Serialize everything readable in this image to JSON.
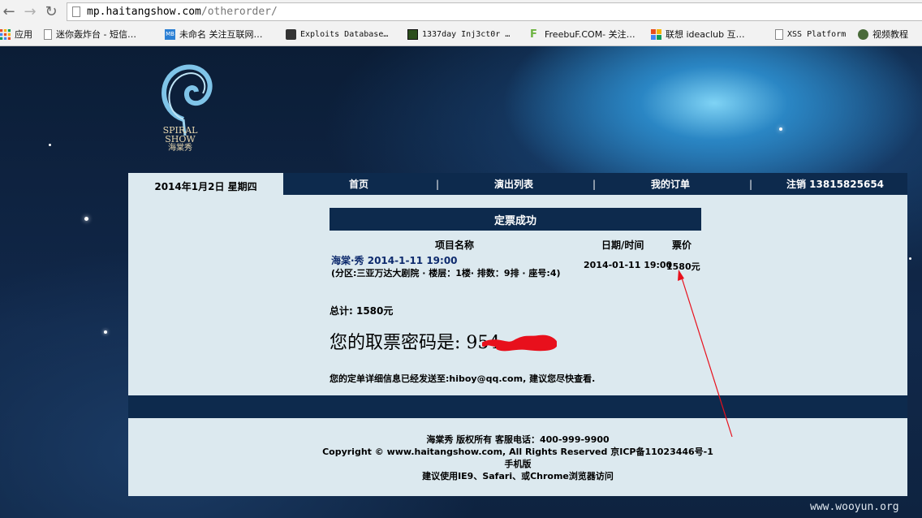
{
  "browser": {
    "url_host": "mp.haitangshow.com",
    "url_path": "/otherorder/",
    "bookmarks": [
      {
        "label": "应用",
        "icon": "apps-grid-icon",
        "color": "#e34c26"
      },
      {
        "label": "迷你轰炸台 - 短信…",
        "icon": "page-icon",
        "color": "#ffffff"
      },
      {
        "label": "未命名 关注互联网…",
        "icon": "mb-icon",
        "color": "#2a7fd4"
      },
      {
        "label": "Exploits Database…",
        "icon": "exploit-db-icon",
        "color": "#333333"
      },
      {
        "label": "1337day Inj3ct0r …",
        "icon": "1337day-icon",
        "color": "#2c4d1c"
      },
      {
        "label": "FreebuF.COM- 关注…",
        "icon": "freebuf-icon",
        "color": "#6cb33f"
      },
      {
        "label": "联想 ideaclub 互…",
        "icon": "lenovo-icon",
        "color": "#e94e1b"
      },
      {
        "label": "XSS Platform",
        "icon": "page-icon",
        "color": "#ffffff"
      },
      {
        "label": "视频教程",
        "icon": "avatar-icon",
        "color": "#4a6b3a"
      }
    ]
  },
  "site": {
    "logo_line1": "SPIRAL",
    "logo_line2": "SHOW",
    "logo_line3": "海棠秀"
  },
  "nav": {
    "date": "2014年1月2日 星期四",
    "home": "首页",
    "shows": "演出列表",
    "orders": "我的订单",
    "logout": "注销 13815825654",
    "separator": "|"
  },
  "order": {
    "title": "定票成功",
    "col_item": "项目名称",
    "col_datetime": "日期/时间",
    "col_price": "票价",
    "item_name": "海棠·秀 2014-1-11 19:00",
    "item_detail": "(分区:三亚万达大剧院 · 楼层：1楼· 排数：9排 · 座号:4)",
    "item_datetime": "2014-01-11 19:00",
    "item_price": "1580元",
    "total": "总计: 1580元",
    "code_label": "您的取票密码是: ",
    "code_visible": "954",
    "notice": "您的定单详细信息已经发送至:hiboy@qq.com, 建议您尽快查看."
  },
  "footer": {
    "line1": "海棠秀 版权所有 客服电话：400-999-9900",
    "line2": "Copyright © www.haitangshow.com, All Rights Reserved 京ICP备11023446号-1",
    "line3": "手机版",
    "line4": "建议使用IE9、Safari、或Chrome浏览器访问"
  },
  "watermark": "www.wooyun.org"
}
